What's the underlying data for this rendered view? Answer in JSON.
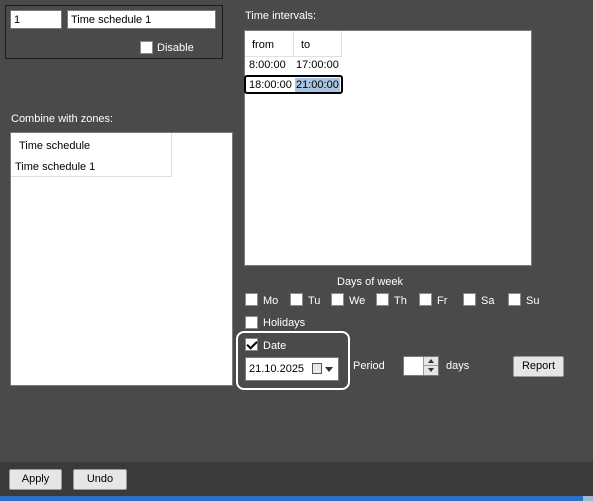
{
  "schedule": {
    "id_value": "1",
    "name_value": "Time schedule 1",
    "disable_label": "Disable",
    "disable_checked": false
  },
  "zones": {
    "label": "Combine with zones:",
    "column_header": "Time schedule",
    "rows": [
      "Time schedule 1"
    ]
  },
  "intervals": {
    "label": "Time intervals:",
    "col_from": "from",
    "col_to": "to",
    "rows": [
      {
        "from": "8:00:00",
        "to": "17:00:00"
      },
      {
        "from": "18:00:00",
        "to": "21:00:00"
      }
    ]
  },
  "days": {
    "label": "Days of week",
    "items": [
      {
        "label": "Mo",
        "checked": false
      },
      {
        "label": "Tu",
        "checked": false
      },
      {
        "label": "We",
        "checked": false
      },
      {
        "label": "Th",
        "checked": false
      },
      {
        "label": "Fr",
        "checked": false
      },
      {
        "label": "Sa",
        "checked": false
      },
      {
        "label": "Su",
        "checked": false
      }
    ],
    "holidays_label": "Holidays",
    "holidays_checked": false
  },
  "date": {
    "label": "Date",
    "checked": true,
    "value": "21.10.2025",
    "period_label": "Period",
    "period_value": "",
    "days_label": "days"
  },
  "buttons": {
    "report": "Report",
    "apply": "Apply",
    "undo": "Undo"
  },
  "colors": {
    "background": "#4a4a4a",
    "highlight_outline": "#ffffff",
    "selected_cell": "#a8c4e0",
    "taskbar": "#2d6fc4"
  }
}
